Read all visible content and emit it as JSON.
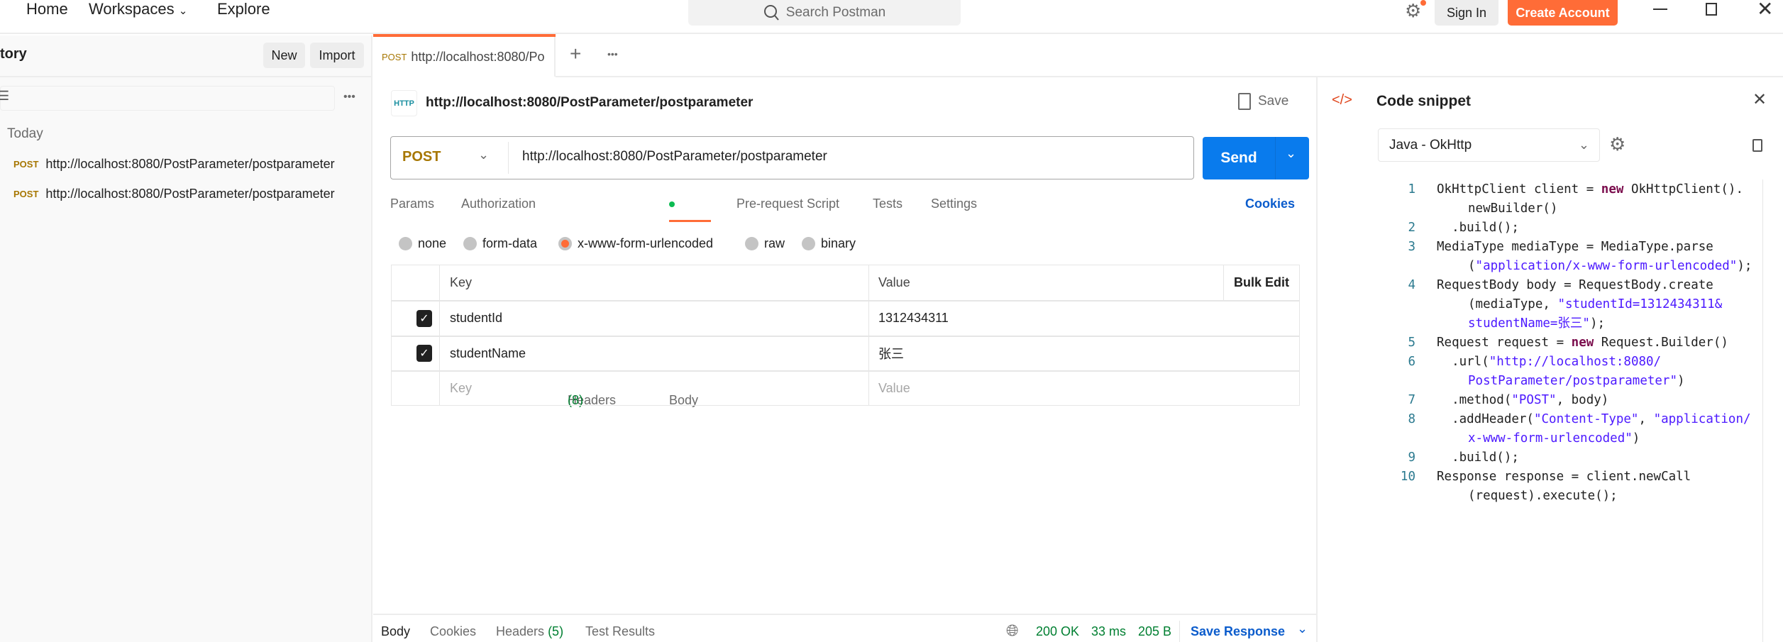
{
  "topnav": {
    "items": [
      "Home",
      "Workspaces",
      "Explore"
    ],
    "search_placeholder": "Search Postman",
    "sign_in": "Sign In",
    "create_account": "Create Account"
  },
  "sidebar": {
    "title": "tory",
    "new": "New",
    "import": "Import",
    "group": "Today",
    "items": [
      {
        "method": "POST",
        "url": "http://localhost:8080/PostParameter/postparameter"
      },
      {
        "method": "POST",
        "url": "http://localhost:8080/PostParameter/postparameter"
      }
    ]
  },
  "tab": {
    "method": "POST",
    "label": "http://localhost:8080/Po"
  },
  "request": {
    "title": "http://localhost:8080/PostParameter/postparameter",
    "save": "Save",
    "method": "POST",
    "url": "http://localhost:8080/PostParameter/postparameter",
    "send": "Send"
  },
  "req_tabs": {
    "params": "Params",
    "authorization": "Authorization",
    "headers": "Headers",
    "headers_count": "(8)",
    "body": "Body",
    "prerequest": "Pre-request Script",
    "tests": "Tests",
    "settings": "Settings",
    "cookies": "Cookies"
  },
  "body_types": [
    "none",
    "form-data",
    "x-www-form-urlencoded",
    "raw",
    "binary"
  ],
  "body_selected": "x-www-form-urlencoded",
  "table": {
    "key_header": "Key",
    "value_header": "Value",
    "bulk_edit": "Bulk Edit",
    "rows": [
      {
        "checked": true,
        "key": "studentId",
        "value": "1312434311"
      },
      {
        "checked": true,
        "key": "studentName",
        "value": "张三"
      }
    ],
    "key_placeholder": "Key",
    "value_placeholder": "Value"
  },
  "response": {
    "tabs": [
      "Body",
      "Cookies",
      "Headers",
      "Test Results"
    ],
    "headers_count": "(5)",
    "status": "200 OK",
    "time": "33 ms",
    "size": "205 B",
    "save_response": "Save Response"
  },
  "snippet": {
    "title": "Code snippet",
    "language": "Java - OkHttp",
    "lines": [
      {
        "n": "1",
        "parts": [
          [
            "OkHttpClient client = ",
            ""
          ],
          [
            "new",
            "kw"
          ],
          [
            " OkHttpClient().",
            ""
          ]
        ],
        "cont": [
          [
            [
              "newBuilder()",
              ""
            ]
          ]
        ]
      },
      {
        "n": "2",
        "parts": [
          [
            "  .build();",
            ""
          ]
        ]
      },
      {
        "n": "3",
        "parts": [
          [
            "MediaType mediaType = MediaType.parse",
            ""
          ]
        ],
        "cont": [
          [
            [
              "(",
              ""
            ],
            [
              "\"application/x-www-form-urlencoded\"",
              "str"
            ],
            [
              ");",
              ""
            ]
          ]
        ]
      },
      {
        "n": "4",
        "parts": [
          [
            "RequestBody body = RequestBody.create",
            ""
          ]
        ],
        "cont": [
          [
            [
              "(mediaType, ",
              ""
            ],
            [
              "\"studentId=1312434311&",
              "str"
            ]
          ],
          [
            [
              "studentName=张三\"",
              "str"
            ],
            [
              ");",
              ""
            ]
          ]
        ]
      },
      {
        "n": "5",
        "parts": [
          [
            "Request request = ",
            ""
          ],
          [
            "new",
            "kw"
          ],
          [
            " Request.Builder()",
            ""
          ]
        ]
      },
      {
        "n": "6",
        "parts": [
          [
            "  .url(",
            ""
          ],
          [
            "\"http://localhost:8080/",
            "str"
          ]
        ],
        "cont": [
          [
            [
              "PostParameter/postparameter\"",
              "str"
            ],
            [
              ")",
              ""
            ]
          ]
        ]
      },
      {
        "n": "7",
        "parts": [
          [
            "  .method(",
            ""
          ],
          [
            "\"POST\"",
            "str"
          ],
          [
            ", body)",
            ""
          ]
        ]
      },
      {
        "n": "8",
        "parts": [
          [
            "  .addHeader(",
            ""
          ],
          [
            "\"Content-Type\"",
            "str"
          ],
          [
            ", ",
            ""
          ],
          [
            "\"application/",
            "str"
          ]
        ],
        "cont": [
          [
            [
              "x-www-form-urlencoded\"",
              "str"
            ],
            [
              ")",
              ""
            ]
          ]
        ]
      },
      {
        "n": "9",
        "parts": [
          [
            "  .build();",
            ""
          ]
        ]
      },
      {
        "n": "10",
        "parts": [
          [
            "Response response = client.newCall",
            ""
          ]
        ],
        "cont": [
          [
            [
              "(request).execute();",
              ""
            ]
          ]
        ]
      }
    ]
  },
  "colors": {
    "accent": "#ff6c37",
    "send": "#097bed",
    "link": "#0b5ccc",
    "success": "#007f31",
    "method_post": "#a77703"
  }
}
